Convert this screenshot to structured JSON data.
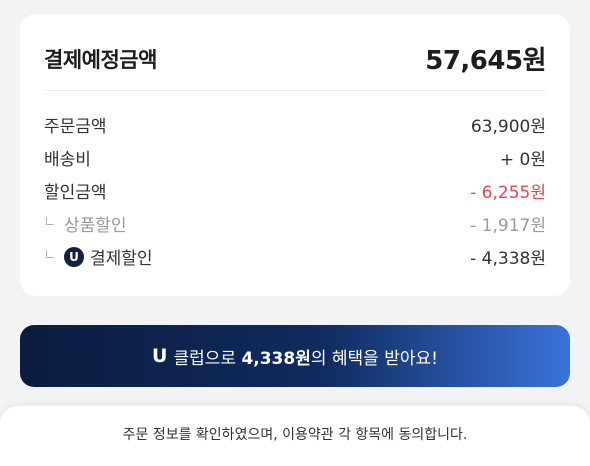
{
  "summary": {
    "total_label": "결제예정금액",
    "total_value": "57,645원",
    "rows": [
      {
        "label": "주문금액",
        "value": "63,900원"
      },
      {
        "label": "배송비",
        "value": "+ 0원"
      },
      {
        "label": "할인금액",
        "value": "- 6,255원"
      }
    ],
    "sub_rows": [
      {
        "label": "상품할인",
        "value": "- 1,917원"
      },
      {
        "label": "결제할인",
        "badge": "U",
        "value": "- 4,338원"
      }
    ]
  },
  "banner": {
    "logo": "U",
    "part1": "클럽으로",
    "amount": "4,338원",
    "part2": "의 혜택을 받아요!"
  },
  "footer": {
    "agree_text": "주문 정보를 확인하였으며, 이용약관 각 항목에 동의합니다."
  },
  "colors": {
    "discount": "#e5484d",
    "badge_bg": "#13213f",
    "banner_start": "#0b1c3e",
    "banner_end": "#3a72d9"
  }
}
